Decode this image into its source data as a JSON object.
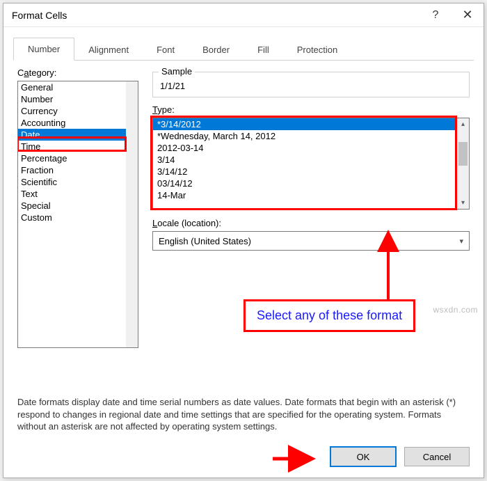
{
  "window": {
    "title": "Format Cells",
    "help_icon": "?",
    "close_icon": "✕"
  },
  "tabs": [
    {
      "label": "Number",
      "active": true
    },
    {
      "label": "Alignment",
      "active": false
    },
    {
      "label": "Font",
      "active": false
    },
    {
      "label": "Border",
      "active": false
    },
    {
      "label": "Fill",
      "active": false
    },
    {
      "label": "Protection",
      "active": false
    }
  ],
  "category": {
    "label_pre": "C",
    "label_ul": "a",
    "label_post": "tegory:",
    "items": [
      "General",
      "Number",
      "Currency",
      "Accounting",
      "Date",
      "Time",
      "Percentage",
      "Fraction",
      "Scientific",
      "Text",
      "Special",
      "Custom"
    ],
    "selected_index": 4
  },
  "sample": {
    "legend": "Sample",
    "value": "1/1/21"
  },
  "type": {
    "label_ul": "T",
    "label_post": "ype:",
    "items": [
      "*3/14/2012",
      "*Wednesday, March 14, 2012",
      "2012-03-14",
      "3/14",
      "3/14/12",
      "03/14/12",
      "14-Mar"
    ],
    "selected_index": 0
  },
  "locale": {
    "label_ul": "L",
    "label_post": "ocale (location):",
    "value": "English (United States)"
  },
  "description": "Date formats display date and time serial numbers as date values. Date formats that begin with an asterisk (*) respond to changes in regional date and time settings that are specified for the operating system. Formats without an asterisk are not affected by operating system settings.",
  "buttons": {
    "ok": "OK",
    "cancel": "Cancel"
  },
  "annotations": {
    "callout": "Select any of these format"
  },
  "watermark": "wsxdn.com"
}
